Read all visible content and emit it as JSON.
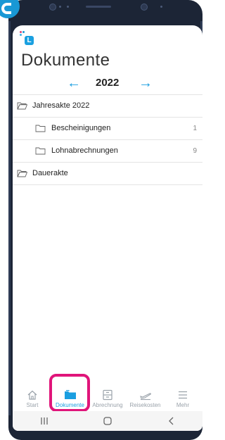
{
  "app": {
    "logo_letter": "L",
    "page_title": "Dokumente",
    "year": "2022"
  },
  "colors": {
    "accent": "#1a9ee0",
    "highlight": "#e0157a"
  },
  "tree": [
    {
      "label": "Jahresakte 2022",
      "level": 0,
      "icon": "folder-open-icon",
      "count": ""
    },
    {
      "label": "Bescheinigungen",
      "level": 1,
      "icon": "folder-icon",
      "count": "1"
    },
    {
      "label": "Lohnabrechnungen",
      "level": 1,
      "icon": "folder-icon",
      "count": "9"
    },
    {
      "label": "Dauerakte",
      "level": 0,
      "icon": "folder-open-icon",
      "count": ""
    }
  ],
  "bottom_nav": [
    {
      "label": "Start",
      "icon": "home-icon",
      "active": false
    },
    {
      "label": "Dokumente",
      "icon": "documents-folder-icon",
      "active": true
    },
    {
      "label": "Abrechnung",
      "icon": "billing-drawer-icon",
      "active": false
    },
    {
      "label": "Reisekosten",
      "icon": "travel-plane-icon",
      "active": false
    },
    {
      "label": "Mehr",
      "icon": "menu-icon",
      "active": false
    }
  ],
  "system_nav": [
    "recents-icon",
    "home-button-icon",
    "back-icon"
  ]
}
